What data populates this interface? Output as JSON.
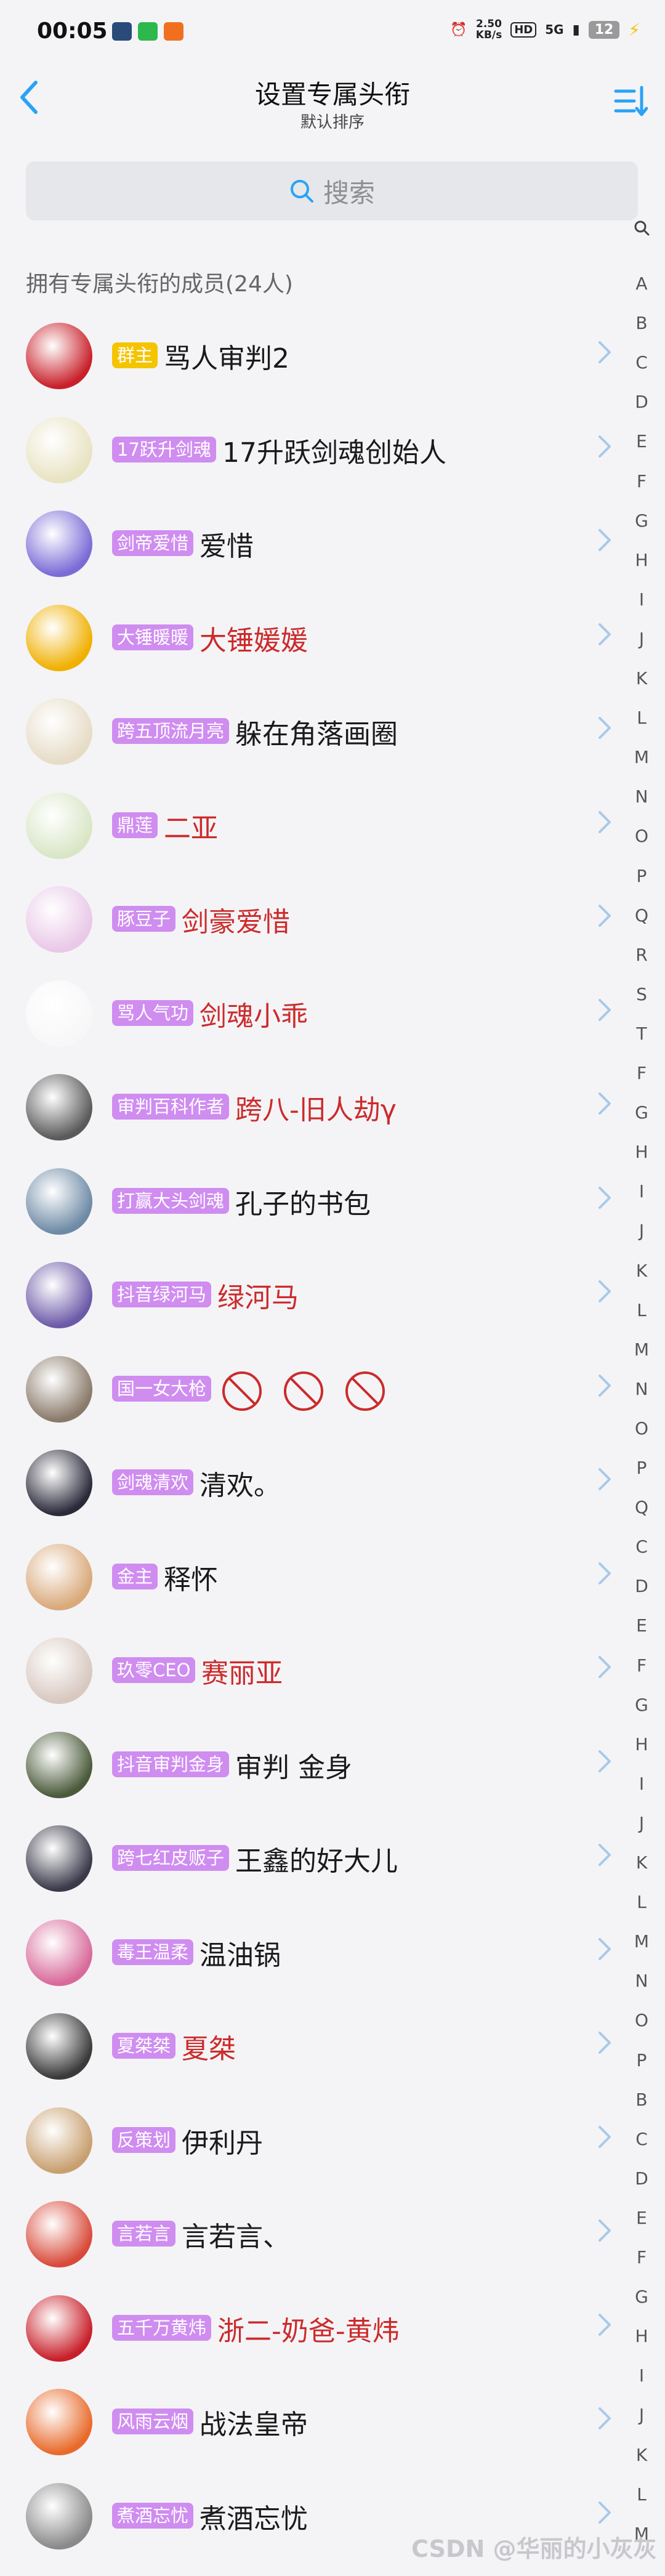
{
  "status_bar": {
    "time": "00:05",
    "speed": "2.50",
    "speed_unit": "KB/s",
    "hd": "HD",
    "network": "5G",
    "battery": "12"
  },
  "header": {
    "title": "设置专属头衔",
    "subtitle": "默认排序"
  },
  "search": {
    "placeholder": "搜索"
  },
  "section_title": "拥有专属头衔的成员(24人)",
  "colors": {
    "accent": "#2aa3f5",
    "tag_purple": "#cf8df0",
    "tag_gold": "#f5c400",
    "name_red": "#cc2b2b"
  },
  "members": [
    {
      "tag": "群主",
      "name": "骂人审判2",
      "tag_color": "#f5c400",
      "name_color": "#1a1a1a",
      "avatar": "#c8202a"
    },
    {
      "tag": "17跃升剑魂",
      "name": "17升跃剑魂创始人",
      "tag_color": "#cf8df0",
      "name_color": "#1a1a1a",
      "avatar": "#e8e3c2"
    },
    {
      "tag": "剑帝爱惜",
      "name": "爱惜",
      "tag_color": "#cf8df0",
      "name_color": "#1a1a1a",
      "avatar": "#7a6bd6"
    },
    {
      "tag": "大锤暖暖",
      "name": "大锤媛媛",
      "tag_color": "#cf8df0",
      "name_color": "#cc2b2b",
      "avatar": "#f0b000"
    },
    {
      "tag": "跨五顶流月亮",
      "name": "躲在角落画圈",
      "tag_color": "#cf8df0",
      "name_color": "#1a1a1a",
      "avatar": "#e6dcc6"
    },
    {
      "tag": "鼎莲",
      "name": "二亚",
      "tag_color": "#cf8df0",
      "name_color": "#cc2b2b",
      "avatar": "#d9e6c6"
    },
    {
      "tag": "豚豆子",
      "name": "剑豪爱惜",
      "tag_color": "#cf8df0",
      "name_color": "#cc2b2b",
      "avatar": "#e9c8e8"
    },
    {
      "tag": "骂人气功",
      "name": "剑魂小乖",
      "tag_color": "#cf8df0",
      "name_color": "#cc2b2b",
      "avatar": "#f7f7f7"
    },
    {
      "tag": "审判百科作者",
      "name": "跨八-旧人劫γ",
      "tag_color": "#cf8df0",
      "name_color": "#cc2b2b",
      "avatar": "#5a5a5a"
    },
    {
      "tag": "打赢大头剑魂",
      "name": "孔子的书包",
      "tag_color": "#cf8df0",
      "name_color": "#1a1a1a",
      "avatar": "#6e8aa6"
    },
    {
      "tag": "抖音绿河马",
      "name": "绿河马",
      "tag_color": "#cf8df0",
      "name_color": "#cc2b2b",
      "avatar": "#6c5aa8"
    },
    {
      "tag": "国一女大枪",
      "name": "",
      "tag_color": "#cf8df0",
      "name_color": "#cc2b2b",
      "avatar": "#8a7a6a"
    },
    {
      "tag": "剑魂清欢",
      "name": "清欢。",
      "tag_color": "#cf8df0",
      "name_color": "#1a1a1a",
      "avatar": "#2a2a3a"
    },
    {
      "tag": "金主",
      "name": "释怀",
      "tag_color": "#cf8df0",
      "name_color": "#1a1a1a",
      "avatar": "#d9a97a"
    },
    {
      "tag": "玖零CEO",
      "name": "赛丽亚",
      "tag_color": "#cf8df0",
      "name_color": "#cc2b2b",
      "avatar": "#d8c8c0"
    },
    {
      "tag": "抖音审判金身",
      "name": "审判  金身",
      "tag_color": "#cf8df0",
      "name_color": "#1a1a1a",
      "avatar": "#4a5a3a"
    },
    {
      "tag": "跨七红皮贩子",
      "name": "王鑫的好大儿",
      "tag_color": "#cf8df0",
      "name_color": "#1a1a1a",
      "avatar": "#3a3a4a"
    },
    {
      "tag": "毒王温柔",
      "name": "温油锅",
      "tag_color": "#cf8df0",
      "name_color": "#1a1a1a",
      "avatar": "#d86a9a"
    },
    {
      "tag": "夏桀桀",
      "name": "夏桀",
      "tag_color": "#cf8df0",
      "name_color": "#cc2b2b",
      "avatar": "#3a3a3a"
    },
    {
      "tag": "反策划",
      "name": "伊利丹",
      "tag_color": "#cf8df0",
      "name_color": "#1a1a1a",
      "avatar": "#c8a070"
    },
    {
      "tag": "言若言",
      "name": "言若言、",
      "tag_color": "#cf8df0",
      "name_color": "#1a1a1a",
      "avatar": "#d84a3a"
    },
    {
      "tag": "五千万黄炜",
      "name": "浙二-奶爸-黄炜",
      "tag_color": "#cf8df0",
      "name_color": "#cc2b2b",
      "avatar": "#c8202a"
    },
    {
      "tag": "风雨云烟",
      "name": "战法皇帝",
      "tag_color": "#cf8df0",
      "name_color": "#1a1a1a",
      "avatar": "#e86a2a"
    },
    {
      "tag": "煮酒忘忧",
      "name": "煮酒忘忧",
      "tag_color": "#cf8df0",
      "name_color": "#1a1a1a",
      "avatar": "#8a8a8a"
    }
  ],
  "index_letters": [
    "A",
    "B",
    "C",
    "D",
    "E",
    "F",
    "G",
    "H",
    "I",
    "J",
    "K",
    "L",
    "M",
    "N",
    "O",
    "P",
    "Q",
    "R",
    "S",
    "T",
    "F",
    "G",
    "H",
    "I",
    "J",
    "K",
    "L",
    "M",
    "N",
    "O",
    "P",
    "Q",
    "C",
    "D",
    "E",
    "F",
    "G",
    "H",
    "I",
    "J",
    "K",
    "L",
    "M",
    "N",
    "O",
    "P",
    "B",
    "C",
    "D",
    "E",
    "F",
    "G",
    "H",
    "I",
    "J",
    "K",
    "L",
    "M"
  ],
  "watermark": "CSDN @华丽的小灰灰"
}
